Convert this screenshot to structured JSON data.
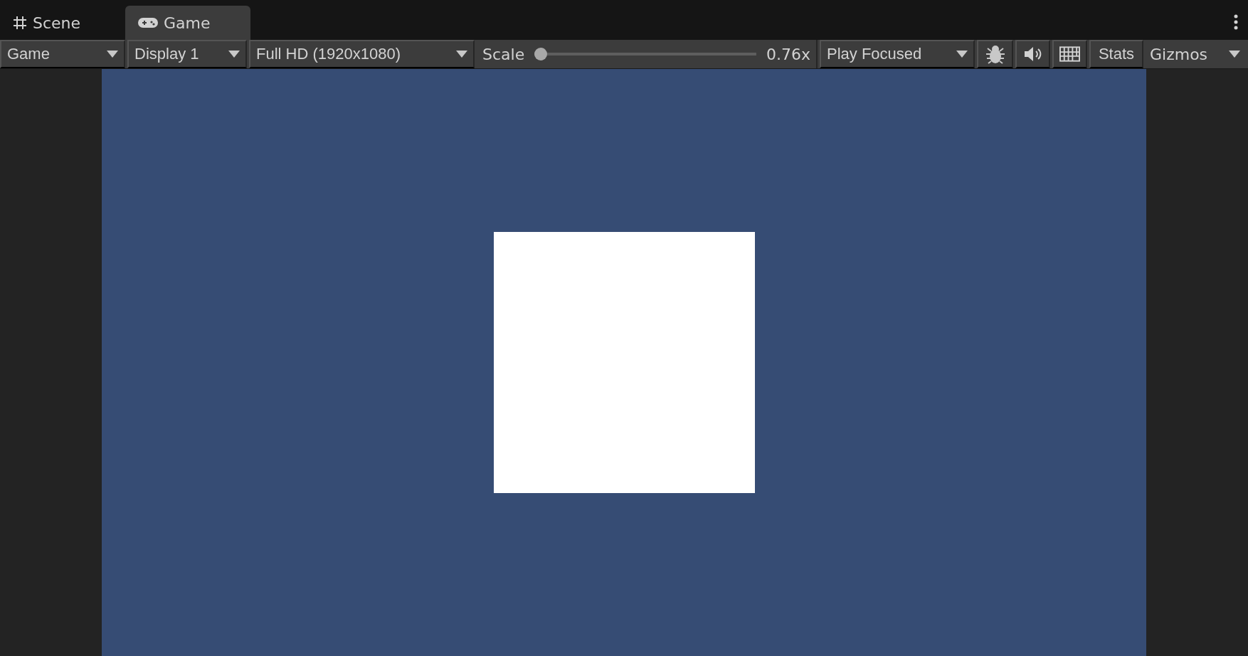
{
  "tabs": [
    {
      "label": "Scene",
      "selected": false
    },
    {
      "label": "Game",
      "selected": true
    }
  ],
  "toolbar": [
    {
      "kind": "dropdown",
      "label": "Game"
    },
    {
      "kind": "dropdown",
      "label": "Display 1"
    },
    {
      "kind": "dropdown",
      "label": "Full HD (1920x1080)"
    },
    {
      "kind": "slider",
      "label": "Scale",
      "level": 0,
      "reading": "0.76x"
    },
    {
      "kind": "dropdown",
      "label": "Play Focused"
    },
    {
      "kind": "icon"
    },
    {
      "kind": "icon"
    },
    {
      "kind": "icon"
    },
    {
      "kind": "toggle",
      "label": "Stats"
    },
    {
      "kind": "split",
      "label": "Gizmos"
    }
  ]
}
